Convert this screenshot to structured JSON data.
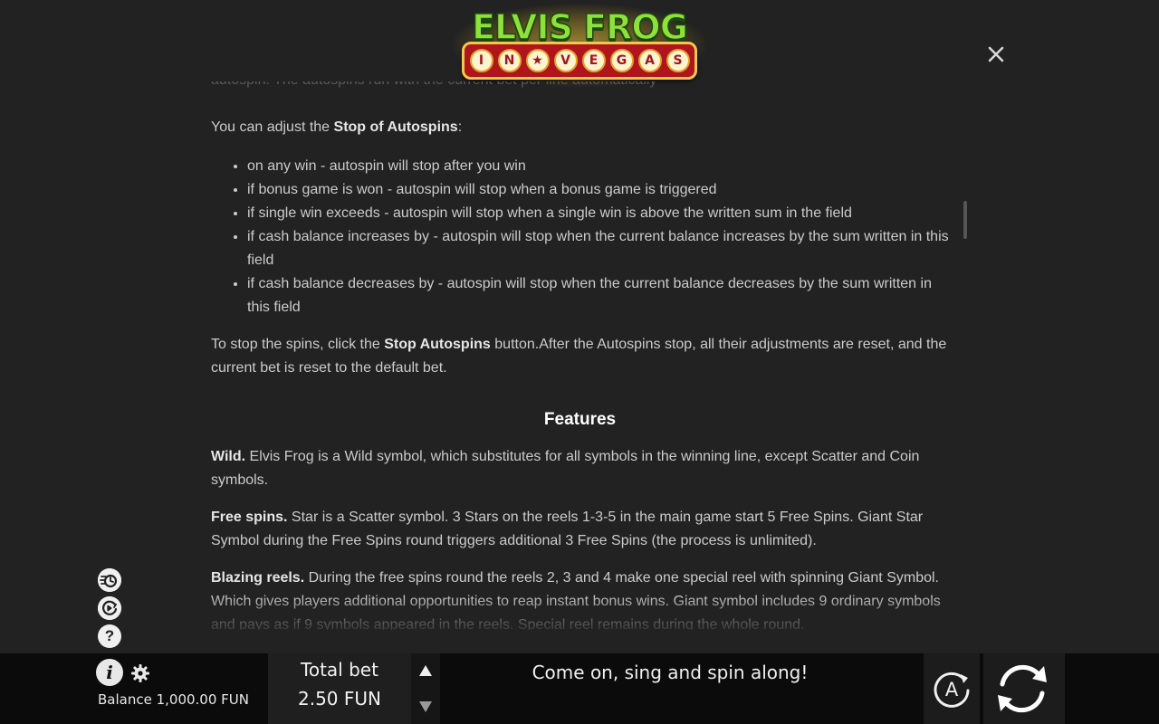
{
  "logo": {
    "title": "ELVIS FROG",
    "sign_letters": [
      "I",
      "N",
      "★",
      "V",
      "E",
      "G",
      "A",
      "S"
    ]
  },
  "close_icon": "close-icon",
  "content": {
    "faded_top_line": "autospin. The autospins run with the current bet per line automatically",
    "adjust_intro_prefix": "You can adjust the ",
    "adjust_intro_bold": "Stop of Autospins",
    "adjust_intro_suffix": ":",
    "stop_options": [
      "on any win - autospin will stop after you win",
      "if bonus game is won - autospin will stop when a bonus game is triggered",
      "if single win exceeds - autospin will stop when a single win is above the written sum in the field",
      "if cash balance increases by - autospin will stop when the current balance increases by the sum written in this field",
      "if cash balance decreases by - autospin will stop when the current balance decreases by the sum written in this field"
    ],
    "stop_para_prefix": "To stop the spins, click the ",
    "stop_para_bold": "Stop Autospins",
    "stop_para_suffix": " button.After the Autospins stop, all their adjustments are reset, and the current bet is reset to the default bet.",
    "features_heading": "Features",
    "wild_bold": "Wild.",
    "wild_text": " Elvis Frog is a Wild symbol, which substitutes for all symbols in the winning line, except Scatter and Coin symbols.",
    "free_bold": "Free spins.",
    "free_text": " Star is a Scatter symbol. 3 Stars on the reels 1-3-5 in the main game start 5 Free Spins. Giant Star Symbol during the Free Spins round triggers additional 3 Free Spins (the process is unlimited).",
    "blazing_bold": "Blazing reels.",
    "blazing_text": " During the free spins round the reels 2, 3 and 4 make one special reel with spinning Giant Symbol. Which gives players additional opportunities to reap instant bonus wins. Giant symbol includes 9 ordinary symbols and pays as if 9 symbols appeared in the reels. Special reel remains during the whole round."
  },
  "side_icons": {
    "turbo": "turbo-icon",
    "autoplay": "autoplay-icon",
    "help": "?"
  },
  "bottom": {
    "info_label": "i",
    "balance_text": "Balance 1,000.00 FUN",
    "total_bet_label": "Total bet",
    "total_bet_value": "2.50 FUN",
    "message": "Come on, sing and spin along!",
    "auto_label": "A"
  },
  "colors": {
    "background": "#222222",
    "bottom_bar": "#0b0b0b",
    "text": "#cbcbcb",
    "heading": "#ffffff",
    "logo_green": "#8fe03a",
    "logo_red": "#b0151d",
    "logo_gold": "#f2c84b"
  }
}
